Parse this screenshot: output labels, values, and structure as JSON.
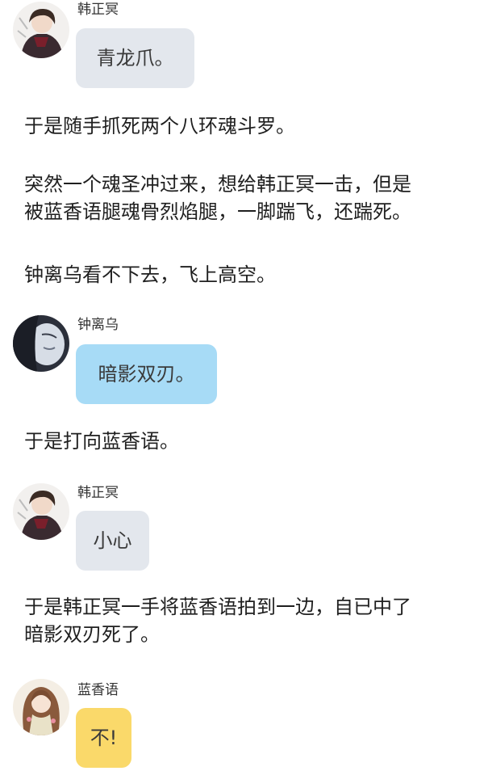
{
  "messages": [
    {
      "sender": "韩正冥",
      "text": "青龙爪。",
      "bubble_color": "#e3e7ed",
      "avatar": "dark-haired-boy-avatar"
    },
    {
      "sender": "钟离乌",
      "text": "暗影双刃。",
      "bubble_color": "#a7dbf6",
      "avatar": "dark-figure-avatar"
    },
    {
      "sender": "韩正冥",
      "text": "小心",
      "bubble_color": "#e3e7ed",
      "avatar": "dark-haired-boy-avatar"
    },
    {
      "sender": "蓝香语",
      "text": "不!",
      "bubble_color": "#fad96a",
      "avatar": "long-haired-girl-avatar"
    }
  ],
  "narration": {
    "p1": "于是随手抓死两个八环魂斗罗。",
    "p2_line1": "突然一个魂圣冲过来，想给韩正冥一击，但是",
    "p2_line2": "被蓝香语腿魂骨烈焰腿，一脚踹飞，还踹死。",
    "p3": "钟离乌看不下去，飞上高空。",
    "p4": "于是打向蓝香语。",
    "p5_line1": "于是韩正冥一手将蓝香语拍到一边，自已中了",
    "p5_line2": "暗影双刃死了。"
  }
}
